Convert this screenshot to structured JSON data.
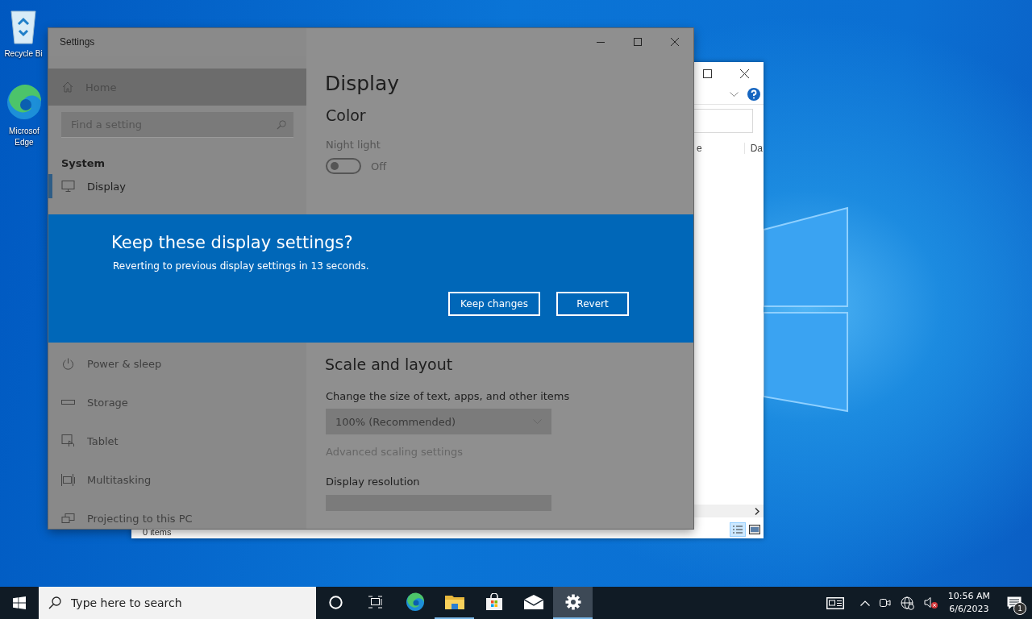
{
  "desktop_icons": [
    {
      "label_lines": [
        "Recycle Bi"
      ]
    },
    {
      "label_lines": [
        "Microsof",
        "Edge"
      ]
    }
  ],
  "explorer_window": {
    "column_1": "e",
    "column_2": "Da",
    "status": "0 items"
  },
  "settings_window": {
    "title": "Settings",
    "home": "Home",
    "search": {
      "placeholder": "Find a setting"
    },
    "section": "System",
    "nav_items": [
      {
        "label": "Display",
        "selected": true
      },
      {
        "label": "Power & sleep",
        "selected": false
      },
      {
        "label": "Storage",
        "selected": false
      },
      {
        "label": "Tablet",
        "selected": false
      },
      {
        "label": "Multitasking",
        "selected": false
      },
      {
        "label": "Projecting to this PC",
        "selected": false
      }
    ],
    "page_title": "Display",
    "color_heading": "Color",
    "night_light": {
      "label": "Night light",
      "on": false,
      "state_text": "Off"
    },
    "scale_heading": "Scale and layout",
    "size_label": "Change the size of text, apps, and other items",
    "size_dropdown": "100% (Recommended)",
    "advanced_link": "Advanced scaling settings",
    "resolution_label": "Display resolution"
  },
  "dialog": {
    "title": "Keep these display settings?",
    "message": "Reverting to previous display settings in 13 seconds.",
    "buttons": [
      "Keep changes",
      "Revert"
    ]
  },
  "taskbar": {
    "search": {
      "placeholder": "Type here to search"
    },
    "apps": [
      {
        "kind": "cortana",
        "running": false,
        "selected": false
      },
      {
        "kind": "taskview",
        "running": false,
        "selected": false
      },
      {
        "kind": "edge",
        "running": false,
        "selected": false
      },
      {
        "kind": "explorer",
        "running": true,
        "selected": false
      },
      {
        "kind": "store",
        "running": false,
        "selected": false
      },
      {
        "kind": "mail",
        "running": false,
        "selected": false
      },
      {
        "kind": "settings",
        "running": true,
        "selected": true
      }
    ],
    "clock": {
      "time": "10:56 AM",
      "date": "6/6/2023"
    },
    "notifications": "1"
  }
}
